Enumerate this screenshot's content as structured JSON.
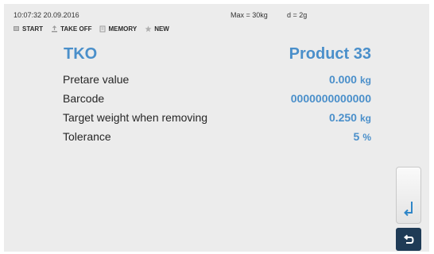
{
  "status": {
    "datetime": "10:07:32 20.09.2016",
    "max": "Max = 30kg",
    "division": "d = 2g"
  },
  "toolbar": {
    "items": [
      {
        "label": "START",
        "icon": "start-icon"
      },
      {
        "label": "TAKE OFF",
        "icon": "take-off-icon"
      },
      {
        "label": "MEMORY",
        "icon": "memory-icon"
      },
      {
        "label": "NEW",
        "icon": "star-icon"
      }
    ]
  },
  "header": {
    "title": "TKO",
    "product": "Product 33"
  },
  "rows": [
    {
      "label": "Pretare value",
      "value": "0.000",
      "unit": "kg"
    },
    {
      "label": "Barcode",
      "value": "0000000000000",
      "unit": ""
    },
    {
      "label": "Target weight when removing",
      "value": "0.250",
      "unit": "kg"
    },
    {
      "label": "Tolerance",
      "value": "5",
      "unit": "%"
    }
  ],
  "buttons": {
    "enter": "enter-icon",
    "back": "back-icon"
  },
  "colors": {
    "accent": "#4a8fca",
    "background": "#ececec",
    "back_button": "#1f3b56"
  }
}
